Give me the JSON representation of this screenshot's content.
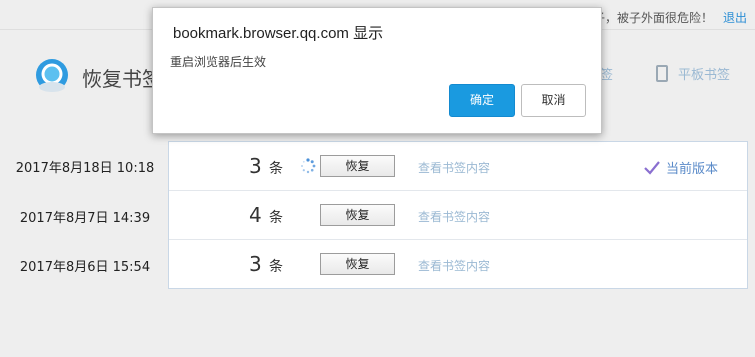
{
  "header": {
    "notice": "子，被子外面很危险！",
    "logout": "退出"
  },
  "brand": {
    "title": "恢复书签"
  },
  "tabs": {
    "pc": "签",
    "pad": "平板书签"
  },
  "records": [
    {
      "date": "2017年8月18日 10:18",
      "count": "3",
      "unit": "条",
      "restore": "恢复",
      "view": "查看书签内容",
      "status": "当前版本"
    },
    {
      "date": "2017年8月7日 14:39",
      "count": "4",
      "unit": "条",
      "restore": "恢复",
      "view": "查看书签内容"
    },
    {
      "date": "2017年8月6日 15:54",
      "count": "3",
      "unit": "条",
      "restore": "恢复",
      "view": "查看书签内容"
    }
  ],
  "dialog": {
    "title": "bookmark.browser.qq.com 显示",
    "message": "重启浏览器后生效",
    "ok": "确定",
    "cancel": "取消"
  },
  "icons": [
    "qq-browser-logo-icon",
    "tablet-icon",
    "loading-spinner-icon",
    "checkmark-icon"
  ],
  "colors": {
    "accent": "#1a9ae0",
    "link": "#9bb9d3",
    "current": "#5b8bc9"
  }
}
